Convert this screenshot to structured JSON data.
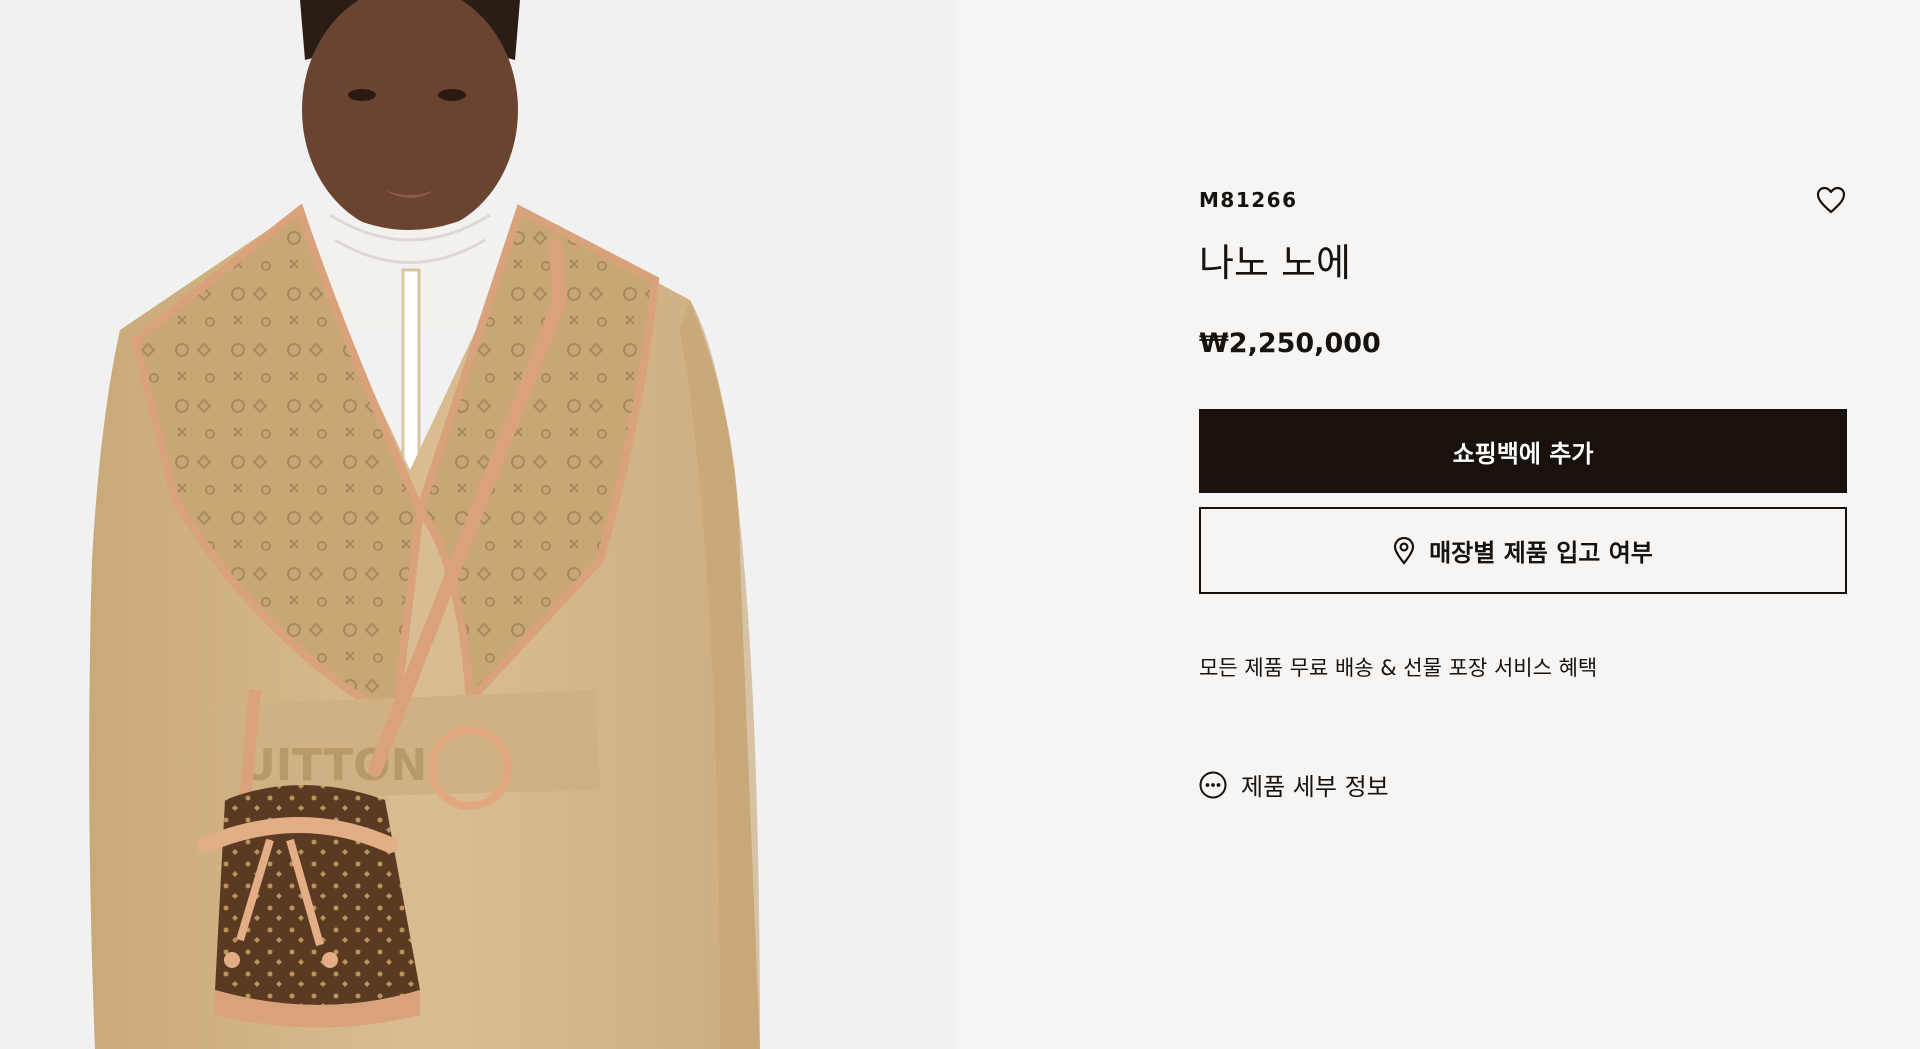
{
  "product": {
    "sku": "M81266",
    "name": "나노 노에",
    "price": "₩2,250,000"
  },
  "actions": {
    "add_to_bag_label": "쇼핑백에 추가",
    "store_availability_label": "매장별 제품 입고 여부"
  },
  "promo_text": "모든 제품 무료 배송 & 선물 포장 서비스 혜택",
  "details_link_label": "제품 세부 정보",
  "icons": {
    "wishlist": "heart-icon",
    "store": "location-pin-icon",
    "details": "more-dots-icon"
  },
  "colors": {
    "brand_dark": "#19110b",
    "panel_bg": "#f6f5f3",
    "image_bg": "#f1f1f1",
    "coat_beige": "#d4b68a",
    "monogram_tan": "#c7a574",
    "leather": "#d9a27a",
    "canvas_brown": "#5a3a22"
  }
}
